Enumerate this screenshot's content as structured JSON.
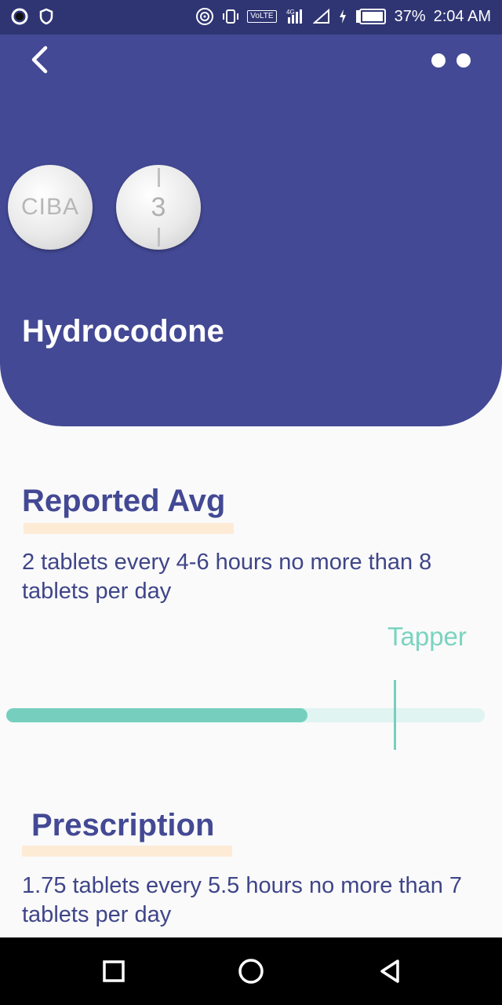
{
  "status_bar": {
    "battery": "37%",
    "time": "2:04 AM",
    "network_label": "VoLTE",
    "network_gen": "4G"
  },
  "header": {
    "drug_name": "Hydrocodone",
    "pill_1_imprint": "CIBA",
    "pill_2_imprint": "3",
    "icons": {
      "back": "back-chevron-icon",
      "menu": "dots-menu-icon"
    },
    "colors": {
      "background": "#434994"
    }
  },
  "reported": {
    "title": "Reported Avg",
    "text": "2 tablets every 4-6 hours no more than 8 tablets per day"
  },
  "taper": {
    "label": "Tapper",
    "progress_fraction": 0.63,
    "marker_fraction": 0.81,
    "colors": {
      "fill": "#76cfbe",
      "track": "#e0f4f1"
    }
  },
  "prescription": {
    "title": "Prescription",
    "text": "1.75 tablets every 5.5 hours no more than 7 tablets per day"
  },
  "navigation": {
    "icons": [
      "recent-apps-icon",
      "home-icon",
      "back-icon"
    ]
  }
}
